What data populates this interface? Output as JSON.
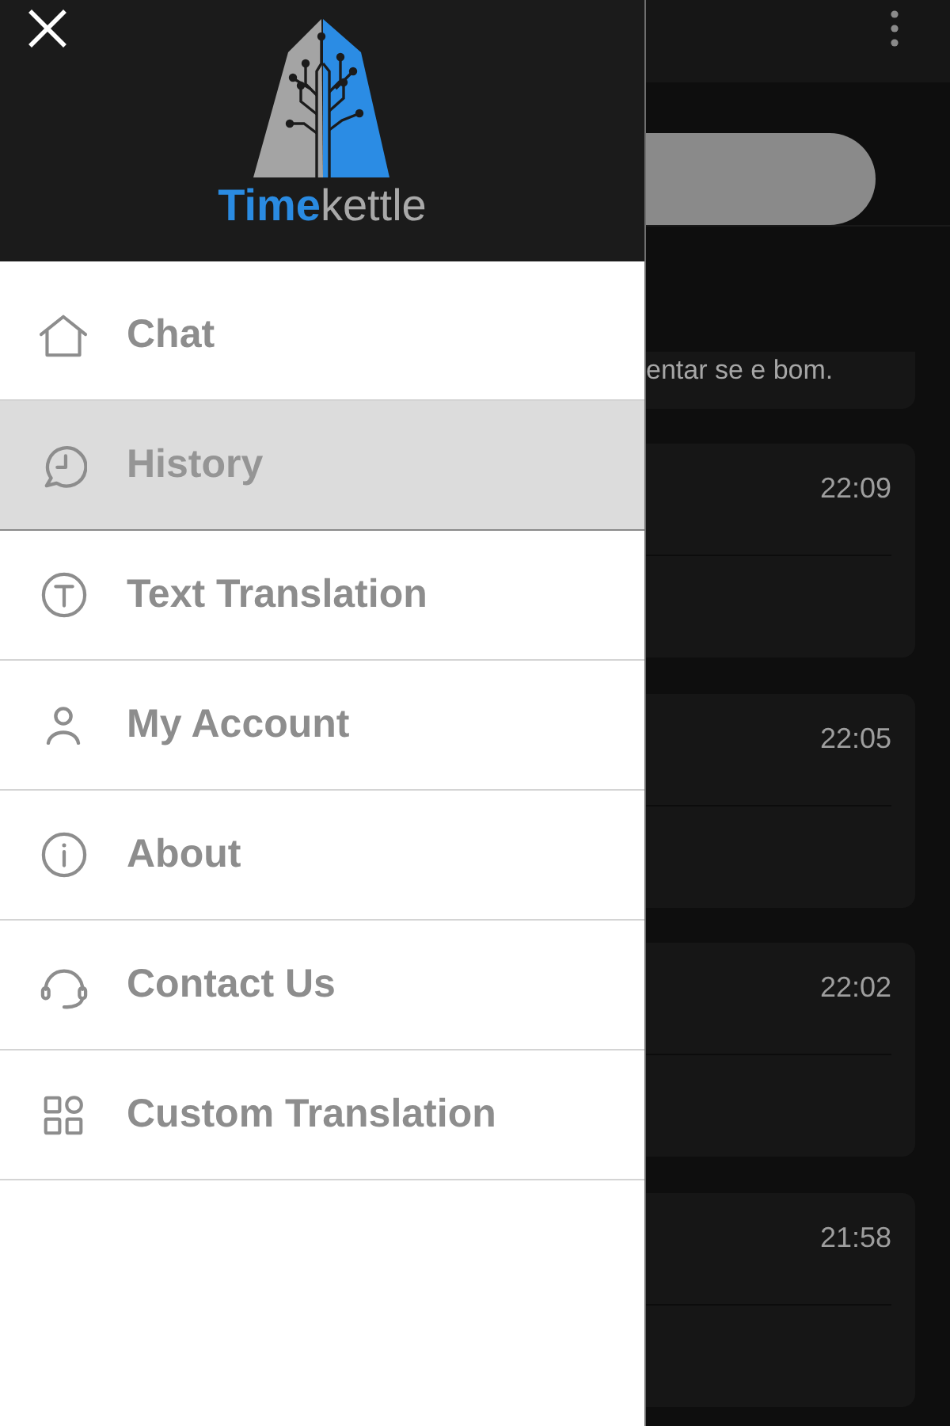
{
  "drawer": {
    "brand": "**Time**kettle",
    "menu": [
      {
        "label": "Chat",
        "selected": false
      },
      {
        "label": "History",
        "selected": true
      },
      {
        "label": "Text Translation",
        "selected": false
      },
      {
        "label": "My Account",
        "selected": false
      },
      {
        "label": "About",
        "selected": false
      },
      {
        "label": "Contact Us",
        "selected": false
      },
      {
        "label": "Custom Translation",
        "selected": false
      }
    ]
  },
  "background": {
    "history_partial": {
      "text": "entar se e bom."
    },
    "history_cards": [
      {
        "time": "22:09"
      },
      {
        "time": "22:05"
      },
      {
        "time": "22:02"
      },
      {
        "time": "21:58"
      }
    ]
  }
}
